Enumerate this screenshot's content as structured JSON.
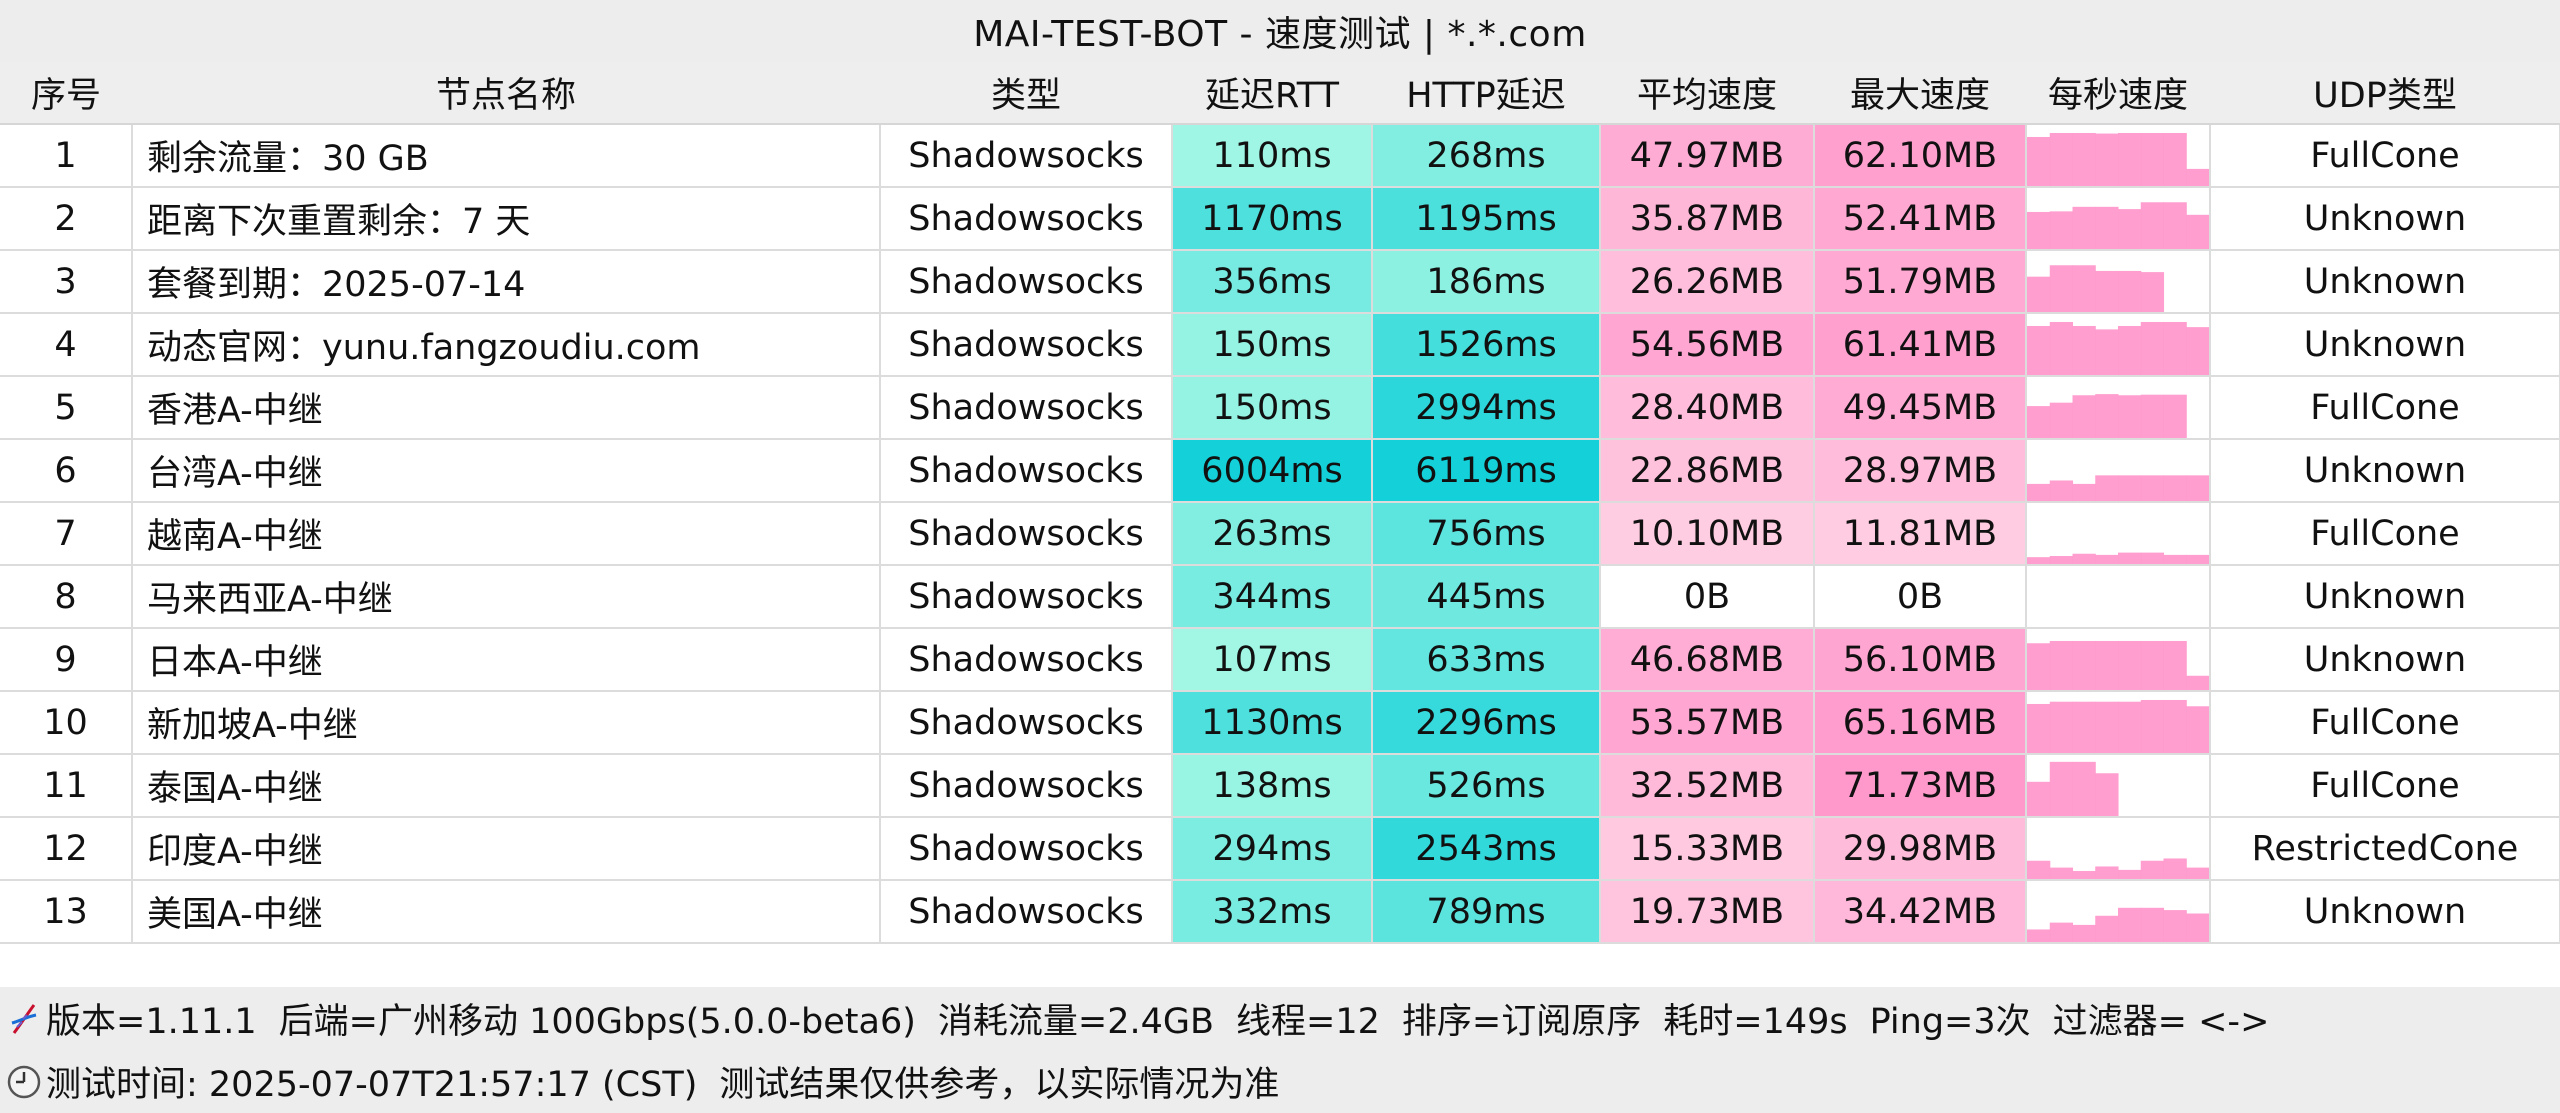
{
  "title": "MAI-TEST-BOT - 速度测试 | *.*.com",
  "headers": [
    "序号",
    "节点名称",
    "类型",
    "延迟RTT",
    "HTTP延迟",
    "平均速度",
    "最大速度",
    "每秒速度",
    "UDP类型"
  ],
  "colors": {
    "rtt_low": "#a3f7e4",
    "rtt_high": "#14d1d9",
    "speed_low": "#ffd6e5",
    "speed_high": "#ff99cc",
    "header_bg": "#eeeeee",
    "footer_bg": "#ededed"
  },
  "rows": [
    {
      "no": "1",
      "name": "剩余流量：30 GB",
      "type": "Shadowsocks",
      "rtt": "110ms",
      "http": "268ms",
      "avg": "47.97MB",
      "max": "62.10MB",
      "udp": "FullCone",
      "spark": [
        0.86,
        0.93,
        0.93,
        0.92,
        0.93,
        0.93,
        0.93,
        0.3
      ]
    },
    {
      "no": "2",
      "name": "距离下次重置剩余：7 天",
      "type": "Shadowsocks",
      "rtt": "1170ms",
      "http": "1195ms",
      "avg": "35.87MB",
      "max": "52.41MB",
      "udp": "Unknown",
      "spark": [
        0.65,
        0.66,
        0.74,
        0.74,
        0.7,
        0.82,
        0.82,
        0.6
      ]
    },
    {
      "no": "3",
      "name": "套餐到期：2025-07-14",
      "type": "Shadowsocks",
      "rtt": "356ms",
      "http": "186ms",
      "avg": "26.26MB",
      "max": "51.79MB",
      "udp": "Unknown",
      "spark": [
        0.62,
        0.82,
        0.82,
        0.72,
        0.72,
        0.7,
        0.0,
        0.0
      ]
    },
    {
      "no": "4",
      "name": "动态官网：yunu.fangzoudiu.com",
      "type": "Shadowsocks",
      "rtt": "150ms",
      "http": "1526ms",
      "avg": "54.56MB",
      "max": "61.41MB",
      "udp": "Unknown",
      "spark": [
        0.86,
        0.93,
        0.86,
        0.8,
        0.86,
        0.93,
        0.93,
        0.84
      ]
    },
    {
      "no": "5",
      "name": "香港A-中继",
      "type": "Shadowsocks",
      "rtt": "150ms",
      "http": "2994ms",
      "avg": "28.40MB",
      "max": "49.45MB",
      "udp": "FullCone",
      "spark": [
        0.56,
        0.62,
        0.75,
        0.77,
        0.75,
        0.76,
        0.76,
        0.0
      ]
    },
    {
      "no": "6",
      "name": "台湾A-中继",
      "type": "Shadowsocks",
      "rtt": "6004ms",
      "http": "6119ms",
      "avg": "22.86MB",
      "max": "28.97MB",
      "udp": "Unknown",
      "spark": [
        0.3,
        0.36,
        0.3,
        0.45,
        0.45,
        0.45,
        0.45,
        0.45
      ]
    },
    {
      "no": "7",
      "name": "越南A-中继",
      "type": "Shadowsocks",
      "rtt": "263ms",
      "http": "756ms",
      "avg": "10.10MB",
      "max": "11.81MB",
      "udp": "FullCone",
      "spark": [
        0.12,
        0.14,
        0.18,
        0.16,
        0.2,
        0.2,
        0.16,
        0.16
      ]
    },
    {
      "no": "8",
      "name": "马来西亚A-中继",
      "type": "Shadowsocks",
      "rtt": "344ms",
      "http": "445ms",
      "avg": "0B",
      "max": "0B",
      "udp": "Unknown",
      "spark": []
    },
    {
      "no": "9",
      "name": "日本A-中继",
      "type": "Shadowsocks",
      "rtt": "107ms",
      "http": "633ms",
      "avg": "46.68MB",
      "max": "56.10MB",
      "udp": "Unknown",
      "spark": [
        0.82,
        0.86,
        0.86,
        0.86,
        0.86,
        0.86,
        0.86,
        0.25
      ]
    },
    {
      "no": "10",
      "name": "新加坡A-中继",
      "type": "Shadowsocks",
      "rtt": "1130ms",
      "http": "2296ms",
      "avg": "53.57MB",
      "max": "65.16MB",
      "udp": "FullCone",
      "spark": [
        0.86,
        0.9,
        0.9,
        0.9,
        0.9,
        0.93,
        0.93,
        0.82
      ]
    },
    {
      "no": "11",
      "name": "泰国A-中继",
      "type": "Shadowsocks",
      "rtt": "138ms",
      "http": "526ms",
      "avg": "32.52MB",
      "max": "71.73MB",
      "udp": "FullCone",
      "spark": [
        0.6,
        0.95,
        0.95,
        0.75,
        0.0,
        0.0,
        0.0,
        0.0
      ]
    },
    {
      "no": "12",
      "name": "印度A-中继",
      "type": "Shadowsocks",
      "rtt": "294ms",
      "http": "2543ms",
      "avg": "15.33MB",
      "max": "29.98MB",
      "udp": "RestrictedCone",
      "spark": [
        0.32,
        0.2,
        0.14,
        0.22,
        0.16,
        0.32,
        0.36,
        0.2
      ]
    },
    {
      "no": "13",
      "name": "美国A-中继",
      "type": "Shadowsocks",
      "rtt": "332ms",
      "http": "789ms",
      "avg": "19.73MB",
      "max": "34.42MB",
      "udp": "Unknown",
      "spark": [
        0.22,
        0.34,
        0.3,
        0.46,
        0.6,
        0.6,
        0.56,
        0.5
      ]
    }
  ],
  "footer": {
    "line1_icon": "dna-icon",
    "line1": [
      "版本=1.11.1",
      "后端=广州移动 100Gbps(5.0.0-beta6)",
      "消耗流量=2.4GB",
      "线程=12",
      "排序=订阅原序",
      "耗时=149s",
      "Ping=3次",
      "过滤器= <->"
    ],
    "line2_icon": "clock-icon",
    "line2": [
      "测试时间: 2025-07-07T21:57:17 (CST)",
      "测试结果仅供参考，以实际情况为准"
    ]
  }
}
